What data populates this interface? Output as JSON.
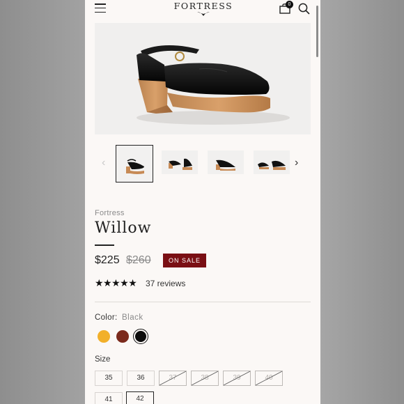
{
  "header": {
    "logo": "FORTRESS",
    "cart_count": "0",
    "icons": [
      "menu-icon",
      "bag-icon",
      "search-icon"
    ]
  },
  "product": {
    "brand": "Fortress",
    "title": "Willow",
    "price": "$225",
    "original_price": "$260",
    "sale_badge": "ON SALE",
    "rating_stars": "★★★★★",
    "rating": 5,
    "reviews": "37 reviews"
  },
  "color": {
    "label": "Color:",
    "value": "Black",
    "swatches": [
      {
        "name": "yellow",
        "hex": "#f2b02a"
      },
      {
        "name": "brown",
        "hex": "#7b2a1c"
      },
      {
        "name": "black",
        "hex": "#0d0d0d"
      }
    ]
  },
  "size": {
    "label": "Size",
    "options": [
      {
        "label": "35",
        "available": true
      },
      {
        "label": "36",
        "available": true
      },
      {
        "label": "37",
        "available": false
      },
      {
        "label": "38",
        "available": false
      },
      {
        "label": "39",
        "available": false
      },
      {
        "label": "40",
        "available": false
      },
      {
        "label": "41",
        "available": true
      },
      {
        "label": "42",
        "available": true,
        "selected": true
      }
    ]
  },
  "colors": {
    "sale_badge": "#7a0f14",
    "background": "#fbf8f6"
  }
}
